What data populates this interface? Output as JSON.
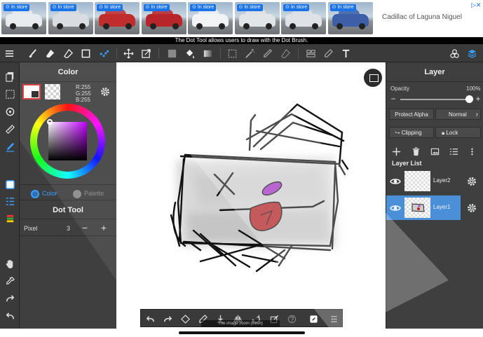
{
  "ad": {
    "badge_label": "In store",
    "cars": [
      {
        "body_color": "#e9ecef"
      },
      {
        "body_color": "#d9dde1"
      },
      {
        "body_color": "#c12d2d"
      },
      {
        "body_color": "#b8262a"
      },
      {
        "body_color": "#f1f3f5"
      },
      {
        "body_color": "#e2e5e8"
      },
      {
        "body_color": "#dfe3e7"
      },
      {
        "body_color": "#3c5fa8"
      }
    ],
    "advertiser": "Cadillac of Laguna Niguel"
  },
  "status": {
    "message": "The Dot Tool allows users to draw with the Dot Brush."
  },
  "toolbar": {
    "icons": [
      "menu-icon",
      "brush-icon",
      "eraser-icon",
      "blend-eraser-icon",
      "square-icon",
      "dot-tool-icon",
      "move-icon",
      "transform-icon",
      "fill-color-icon",
      "bucket-icon",
      "gradient-icon",
      "lasso-select-icon",
      "magic-wand-icon",
      "select-pen-icon",
      "select-eraser-icon",
      "text-icon",
      "material-icon",
      "layers-icon"
    ]
  },
  "color_panel": {
    "title": "Color",
    "r": "R:255",
    "g": "G:255",
    "b": "B:255",
    "tab_color": "Color",
    "tab_palette": "Palette"
  },
  "dot_tool": {
    "title": "Dot Tool",
    "pixel_label": "Pixel",
    "pixel_value": "3",
    "minus": "−",
    "plus": "+"
  },
  "layer_panel": {
    "title": "Layer",
    "opacity_label": "Opacity",
    "opacity_value": "100%",
    "opacity_level": 1.0,
    "minus": "−",
    "plus": "+",
    "protect_alpha": "Protect Alpha",
    "blend_mode": "Normal",
    "clipping": "Clipping",
    "lock": "Lock",
    "list_title": "Layer List",
    "layers": [
      {
        "name": "Layer2",
        "selected": false
      },
      {
        "name": "Layer1",
        "selected": true
      }
    ]
  },
  "bottom_tooltip": "The image zoom (fresh)"
}
